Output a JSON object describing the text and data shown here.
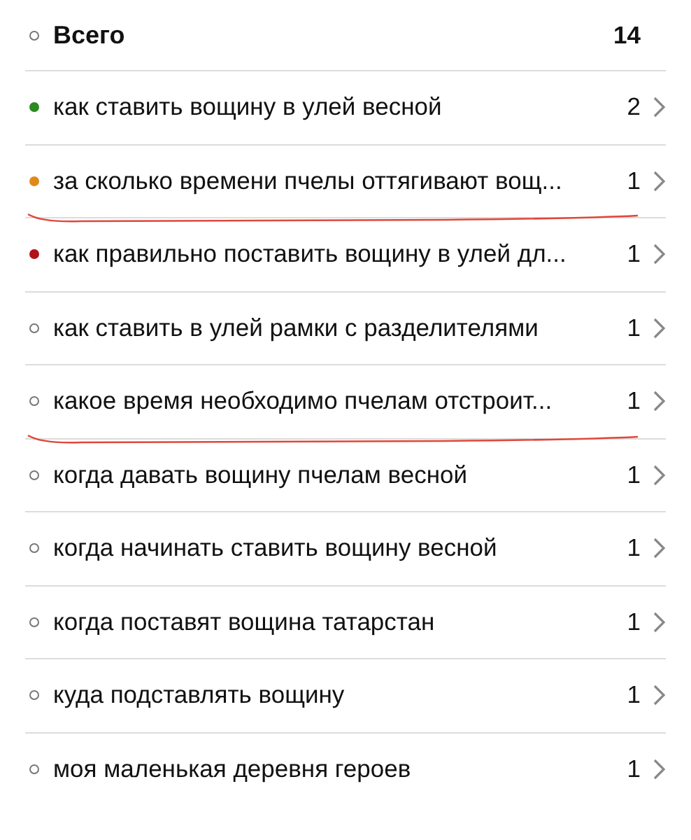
{
  "total": {
    "label": "Всего",
    "count": "14",
    "kind": "hollow"
  },
  "items": [
    {
      "label": "как ставить вощину в улей весной",
      "count": "2",
      "kind": "filled",
      "color": "#2a8a1e",
      "underlined": false
    },
    {
      "label": "за сколько времени пчелы оттягивают вощ...",
      "count": "1",
      "kind": "filled",
      "color": "#e08a1a",
      "underlined": true
    },
    {
      "label": "как правильно поставить вощину в улей дл...",
      "count": "1",
      "kind": "filled",
      "color": "#b0121a",
      "underlined": false
    },
    {
      "label": "как ставить в улей рамки с разделителями",
      "count": "1",
      "kind": "hollow",
      "underlined": false
    },
    {
      "label": "какое время необходимо пчелам отстроит...",
      "count": "1",
      "kind": "hollow",
      "underlined": true
    },
    {
      "label": "когда давать вощину пчелам весной",
      "count": "1",
      "kind": "hollow",
      "underlined": false
    },
    {
      "label": "когда начинать ставить вощину весной",
      "count": "1",
      "kind": "hollow",
      "underlined": false
    },
    {
      "label": "когда поставят вощина татарстан",
      "count": "1",
      "kind": "hollow",
      "underlined": false
    },
    {
      "label": "куда подставлять вощину",
      "count": "1",
      "kind": "hollow",
      "underlined": false
    },
    {
      "label": "моя маленькая деревня героев",
      "count": "1",
      "kind": "hollow",
      "underlined": false
    }
  ]
}
